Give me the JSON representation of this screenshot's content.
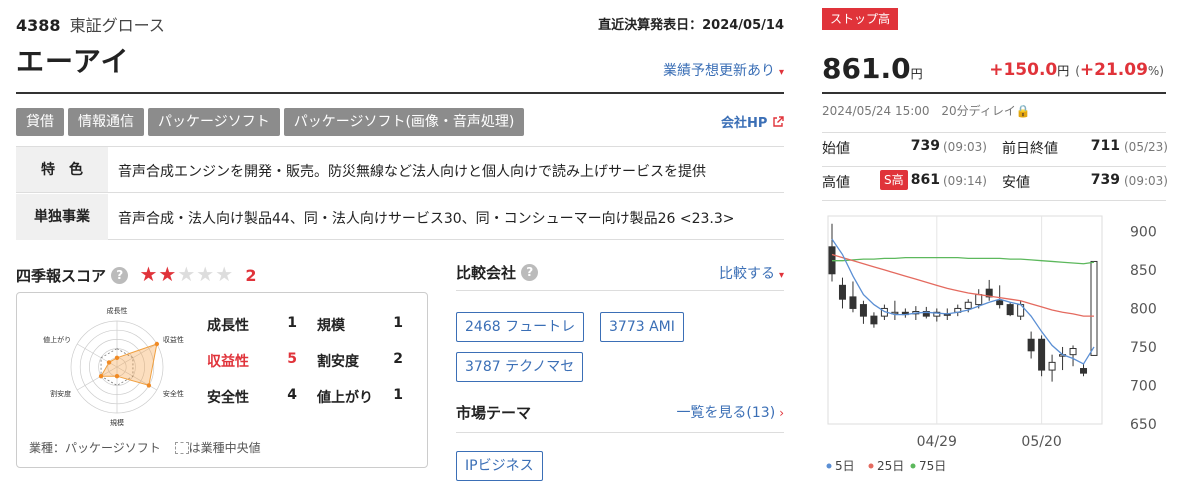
{
  "header": {
    "code": "4388",
    "market": "東証グロース",
    "settlement": "直近決算発表日：2024/05/14",
    "company": "エーアイ",
    "forecast_link": "業績予想更新あり"
  },
  "tags": [
    "貸借",
    "情報通信",
    "パッケージソフト",
    "パッケージソフト(画像・音声処理)"
  ],
  "company_hp": "会社HP",
  "profile": {
    "feature_label": "特　色",
    "feature_text": "音声合成エンジンを開発・販売。防災無線など法人向けと個人向けで読み上げサービスを提供",
    "segment_label": "単独事業",
    "segment_text": "音声合成・法人向け製品44、同・法人向けサービス30、同・コンシューマー向け製品26 <23.3>"
  },
  "score": {
    "title": "四季報スコア",
    "stars_filled": 2,
    "stars_total": 5,
    "value": "2",
    "radar_labels": [
      "成長性",
      "収益性",
      "安全性",
      "規模",
      "割安度",
      "値上がり"
    ],
    "radar_values": [
      1,
      5,
      4,
      1,
      2,
      1
    ],
    "radar_median": [
      2,
      2,
      2,
      2,
      2,
      2
    ],
    "items": [
      {
        "label": "成長性",
        "value": "1",
        "highlight": false
      },
      {
        "label": "規模",
        "value": "1",
        "highlight": false
      },
      {
        "label": "収益性",
        "value": "5",
        "highlight": true
      },
      {
        "label": "割安度",
        "value": "2",
        "highlight": false
      },
      {
        "label": "安全性",
        "value": "4",
        "highlight": false
      },
      {
        "label": "値上がり",
        "value": "1",
        "highlight": false
      }
    ],
    "footer_industry": "業種：パッケージソフト",
    "footer_legend": "は業種中央値"
  },
  "compare": {
    "title": "比較会社",
    "link": "比較する",
    "companies": [
      "2468 フュートレ",
      "3773 AMI",
      "3787 テクノマセ"
    ]
  },
  "theme": {
    "title": "市場テーマ",
    "link": "一覧を見る(13)",
    "items": [
      "IPビジネス"
    ]
  },
  "quote": {
    "badge": "ストップ高",
    "price": "861.0",
    "price_unit": "円",
    "change": "+150.0",
    "change_unit": "円",
    "change_pct": "+21.09",
    "datetime": "2024/05/24 15:00",
    "delay": "20分ディレイ",
    "open_label": "始値",
    "open": "739",
    "open_time": "(09:03)",
    "prev_label": "前日終値",
    "prev": "711",
    "prev_time": "(05/23)",
    "high_label": "高値",
    "high_badge": "S高",
    "high": "861",
    "high_time": "(09:14)",
    "low_label": "安値",
    "low": "739",
    "low_time": "(09:03)"
  },
  "colors": {
    "up": "#e0333a",
    "link": "#3b6fb6",
    "ma5": "#5b8fd4",
    "ma25": "#e46a5f",
    "ma75": "#5cb85c"
  },
  "chart_data": {
    "type": "candlestick",
    "y_ticks": [
      900,
      850,
      800,
      750,
      700,
      650
    ],
    "ylim": [
      650,
      920
    ],
    "x_labels": [
      "04/29",
      "05/20"
    ],
    "legend": [
      "5日",
      "25日",
      "75日"
    ],
    "candles": [
      {
        "o": 880,
        "h": 910,
        "l": 835,
        "c": 845
      },
      {
        "o": 830,
        "h": 840,
        "l": 800,
        "c": 812
      },
      {
        "o": 815,
        "h": 835,
        "l": 795,
        "c": 800
      },
      {
        "o": 805,
        "h": 810,
        "l": 780,
        "c": 790
      },
      {
        "o": 790,
        "h": 795,
        "l": 775,
        "c": 780
      },
      {
        "o": 790,
        "h": 805,
        "l": 785,
        "c": 800
      },
      {
        "o": 795,
        "h": 810,
        "l": 785,
        "c": 795
      },
      {
        "o": 795,
        "h": 800,
        "l": 788,
        "c": 792
      },
      {
        "o": 793,
        "h": 803,
        "l": 785,
        "c": 796
      },
      {
        "o": 796,
        "h": 802,
        "l": 787,
        "c": 790
      },
      {
        "o": 790,
        "h": 800,
        "l": 783,
        "c": 795
      },
      {
        "o": 793,
        "h": 800,
        "l": 785,
        "c": 792
      },
      {
        "o": 795,
        "h": 805,
        "l": 790,
        "c": 800
      },
      {
        "o": 800,
        "h": 812,
        "l": 795,
        "c": 808
      },
      {
        "o": 805,
        "h": 825,
        "l": 800,
        "c": 818
      },
      {
        "o": 825,
        "h": 837,
        "l": 810,
        "c": 815
      },
      {
        "o": 810,
        "h": 830,
        "l": 800,
        "c": 805
      },
      {
        "o": 805,
        "h": 808,
        "l": 790,
        "c": 792
      },
      {
        "o": 790,
        "h": 810,
        "l": 785,
        "c": 805
      },
      {
        "o": 760,
        "h": 770,
        "l": 735,
        "c": 745
      },
      {
        "o": 760,
        "h": 765,
        "l": 712,
        "c": 720
      },
      {
        "o": 720,
        "h": 740,
        "l": 705,
        "c": 730
      },
      {
        "o": 740,
        "h": 750,
        "l": 720,
        "c": 740
      },
      {
        "o": 740,
        "h": 752,
        "l": 725,
        "c": 748
      },
      {
        "o": 722,
        "h": 728,
        "l": 712,
        "c": 716
      },
      {
        "o": 739,
        "h": 861,
        "l": 739,
        "c": 861
      }
    ],
    "ma5": [
      890,
      870,
      842,
      818,
      805,
      796,
      792,
      792,
      794,
      795,
      794,
      793,
      795,
      798,
      803,
      808,
      812,
      808,
      805,
      790,
      770,
      752,
      740,
      735,
      728,
      750
    ],
    "ma25": [
      870,
      866,
      862,
      858,
      854,
      850,
      846,
      842,
      838,
      834,
      830,
      826,
      823,
      820,
      818,
      816,
      814,
      812,
      810,
      806,
      802,
      798,
      795,
      793,
      790,
      790
    ],
    "ma75": [
      862,
      862,
      863,
      864,
      864,
      865,
      865,
      866,
      866,
      866,
      866,
      866,
      866,
      865,
      865,
      865,
      865,
      864,
      864,
      863,
      862,
      861,
      860,
      859,
      858,
      860
    ]
  }
}
